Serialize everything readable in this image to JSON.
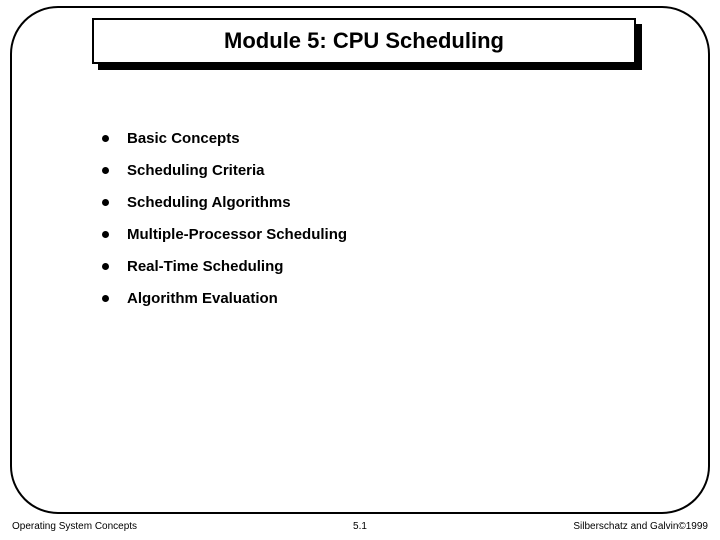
{
  "title": "Module 5:  CPU Scheduling",
  "bullets": [
    "Basic Concepts",
    "Scheduling Criteria",
    "Scheduling Algorithms",
    "Multiple-Processor Scheduling",
    "Real-Time Scheduling",
    "Algorithm Evaluation"
  ],
  "footer": {
    "left": "Operating System Concepts",
    "center": "5.1",
    "right": "Silberschatz and Galvin©1999"
  }
}
